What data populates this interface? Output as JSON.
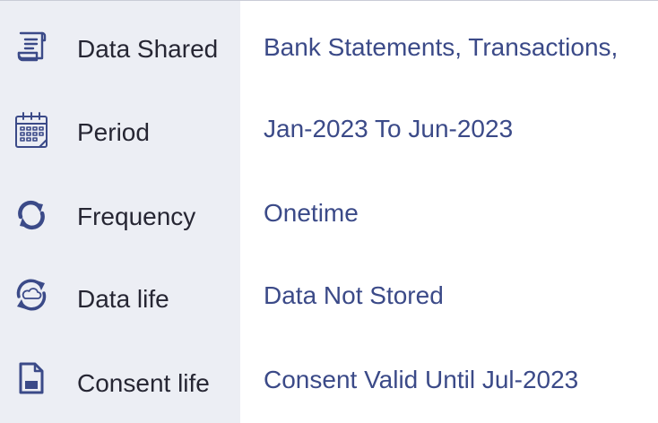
{
  "rows": [
    {
      "icon": "document-scroll-icon",
      "label": "Data Shared",
      "value": "Bank Statements, Transactions,"
    },
    {
      "icon": "calendar-icon",
      "label": "Period",
      "value": "Jan-2023 To Jun-2023"
    },
    {
      "icon": "refresh-icon",
      "label": "Frequency",
      "value": "Onetime"
    },
    {
      "icon": "cloud-sync-icon",
      "label": "Data life",
      "value": "Data Not Stored"
    },
    {
      "icon": "file-icon",
      "label": "Consent life",
      "value": "Consent Valid Until Jul-2023"
    }
  ],
  "colors": {
    "label_column_bg": "#eceef4",
    "icon": "#3b4a88",
    "label_text": "#262633",
    "value_text": "#3b4a88"
  }
}
